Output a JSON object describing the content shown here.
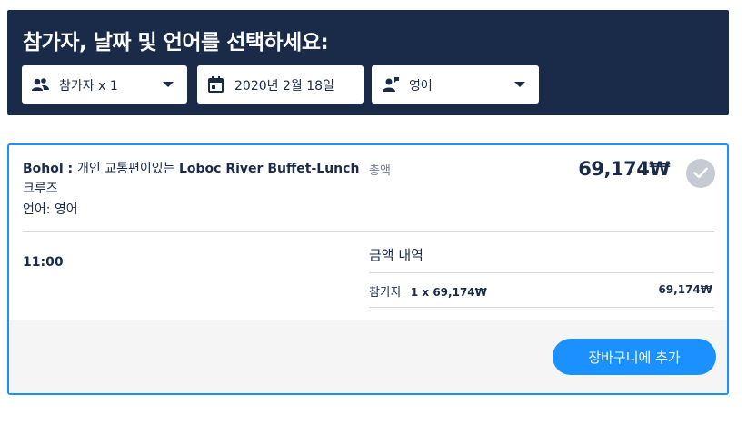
{
  "header": {
    "title": "참가자, 날짜 및 언어를 선택하세요:",
    "participants": {
      "label": "참가자 x 1",
      "icon": "people-icon"
    },
    "date": {
      "label": "2020년 2월 18일",
      "icon": "calendar-icon"
    },
    "language": {
      "label": "영어",
      "icon": "guide-icon"
    }
  },
  "option": {
    "title_prefix": "Bohol : ",
    "title_korean": "개인 교통편이있는 ",
    "title_name": "Loboc River Buffet-Lunch",
    "title_suffix": " 크루즈",
    "language": "언어: 영어",
    "total_label": "총액",
    "total_price": "69,174₩",
    "time": "11:00",
    "breakdown_title": "금액 내역",
    "breakdown": [
      {
        "label": "참가자",
        "qty": "1 x 69,174₩",
        "amount": "69,174₩"
      }
    ],
    "add_to_cart": "장바구니에 추가"
  },
  "colors": {
    "header_bg": "#1a2b49",
    "accent": "#1a91ff",
    "check_bg": "#c6cad2",
    "footer_bg": "#f5f5f5"
  }
}
